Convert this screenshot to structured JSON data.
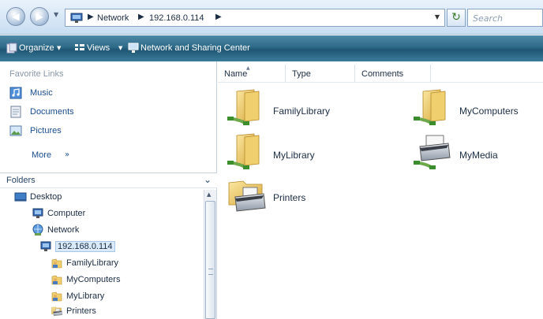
{
  "address_bar": {
    "breadcrumbs": [
      "Network",
      "192.168.0.114"
    ],
    "search_placeholder": "Search"
  },
  "toolbar": {
    "organize_label": "Organize",
    "views_label": "Views",
    "network_sharing_label": "Network and Sharing Center"
  },
  "favorites": {
    "header": "Favorite Links",
    "items": [
      {
        "label": "Music",
        "icon": "music-icon"
      },
      {
        "label": "Documents",
        "icon": "documents-icon"
      },
      {
        "label": "Pictures",
        "icon": "pictures-icon"
      }
    ],
    "more_label": "More",
    "more_arrow": "»"
  },
  "folders": {
    "header": "Folders",
    "tree": [
      {
        "label": "Desktop",
        "icon": "desktop-icon"
      },
      {
        "label": "Computer",
        "icon": "computer-icon"
      },
      {
        "label": "Network",
        "icon": "network-icon"
      },
      {
        "label": "192.168.0.114",
        "icon": "server-icon",
        "selected": true
      },
      {
        "label": "FamilyLibrary",
        "icon": "shared-folder-icon"
      },
      {
        "label": "MyComputers",
        "icon": "shared-folder-icon"
      },
      {
        "label": "MyLibrary",
        "icon": "shared-folder-icon"
      },
      {
        "label": "Printers",
        "icon": "printer-folder-icon"
      }
    ]
  },
  "columns": [
    "Name",
    "Type",
    "Comments"
  ],
  "files": [
    {
      "label": "FamilyLibrary",
      "icon": "shared-folder-icon"
    },
    {
      "label": "MyComputers",
      "icon": "shared-folder-icon"
    },
    {
      "label": "MyLibrary",
      "icon": "shared-folder-icon"
    },
    {
      "label": "MyMedia",
      "icon": "shared-printer-icon"
    },
    {
      "label": "Printers",
      "icon": "printer-folder-icon"
    }
  ],
  "colors": {
    "toolbar": "#2d6a87",
    "link": "#1a4d8c",
    "selection": "#dbeaf9"
  }
}
